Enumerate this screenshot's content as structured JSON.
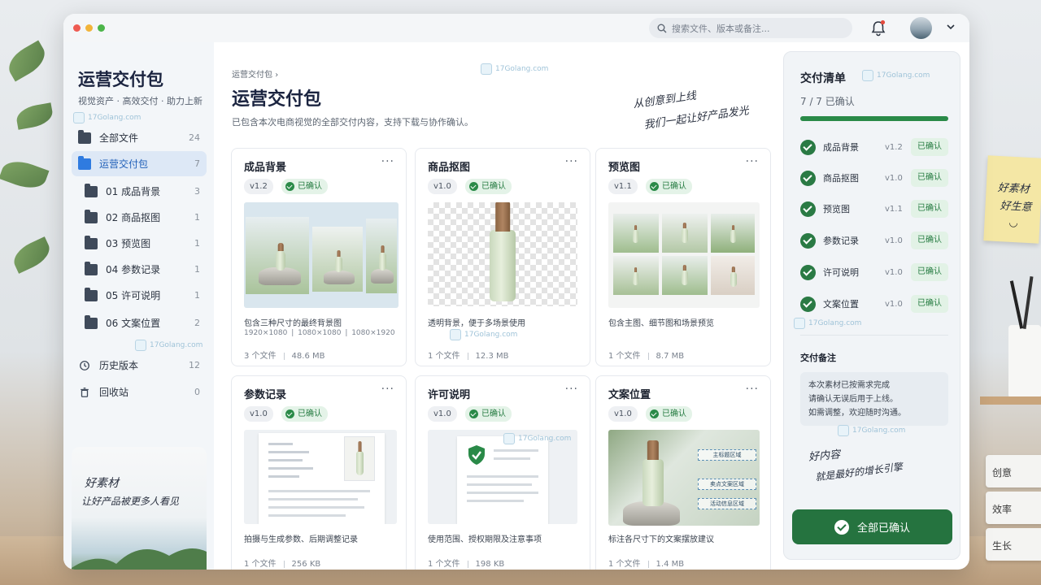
{
  "window": {
    "search_placeholder": "搜索文件、版本或备注..."
  },
  "sidebar": {
    "title": "运营交付包",
    "subtitle": "视觉资产 · 高效交付 · 助力上新",
    "items": [
      {
        "label": "全部文件",
        "count": "24"
      },
      {
        "label": "运营交付包",
        "count": "7"
      },
      {
        "label": "01 成品背景",
        "count": "3"
      },
      {
        "label": "02 商品抠图",
        "count": "1"
      },
      {
        "label": "03 预览图",
        "count": "1"
      },
      {
        "label": "04 参数记录",
        "count": "1"
      },
      {
        "label": "05 许可说明",
        "count": "1"
      },
      {
        "label": "06 文案位置",
        "count": "2"
      },
      {
        "label": "历史版本",
        "count": "12"
      },
      {
        "label": "回收站",
        "count": "0"
      }
    ],
    "promo_line1": "好素材",
    "promo_line2": "让好产品被更多人看见"
  },
  "main": {
    "breadcrumb": "运营交付包",
    "title": "运营交付包",
    "description": "已包含本次电商视觉的全部交付内容，支持下载与协作确认。",
    "handwriting_1": "从创意到上线",
    "handwriting_2": "我们一起让好产品发光",
    "cards": [
      {
        "title": "成品背景",
        "version": "v1.2",
        "status": "已确认",
        "desc": "包含三种尺寸的最终背景图",
        "dims": "1920×1080 | 1080×1080 | 1080×1920",
        "files": "3 个文件",
        "size": "48.6 MB"
      },
      {
        "title": "商品抠图",
        "version": "v1.0",
        "status": "已确认",
        "desc": "透明背景，便于多场景使用",
        "dims": "",
        "files": "1 个文件",
        "size": "12.3 MB"
      },
      {
        "title": "预览图",
        "version": "v1.1",
        "status": "已确认",
        "desc": "包含主图、细节图和场景预览",
        "dims": "",
        "files": "1 个文件",
        "size": "8.7 MB"
      },
      {
        "title": "参数记录",
        "version": "v1.0",
        "status": "已确认",
        "desc": "拍摄与生成参数、后期调整记录",
        "dims": "",
        "files": "1 个文件",
        "size": "256 KB"
      },
      {
        "title": "许可说明",
        "version": "v1.0",
        "status": "已确认",
        "desc": "使用范围、授权期限及注意事项",
        "dims": "",
        "files": "1 个文件",
        "size": "198 KB"
      },
      {
        "title": "文案位置",
        "version": "v1.0",
        "status": "已确认",
        "desc": "标注各尺寸下的文案摆放建议",
        "dims": "",
        "files": "1 个文件",
        "size": "1.4 MB"
      }
    ],
    "copy_zones": [
      "主标题区域",
      "卖点文案区域",
      "活动信息区域"
    ]
  },
  "checklist": {
    "title": "交付清单",
    "count": "7 / 7  已确认",
    "progress": 1.0,
    "items": [
      {
        "label": "成品背景",
        "version": "v1.2",
        "status": "已确认"
      },
      {
        "label": "商品抠图",
        "version": "v1.0",
        "status": "已确认"
      },
      {
        "label": "预览图",
        "version": "v1.1",
        "status": "已确认"
      },
      {
        "label": "参数记录",
        "version": "v1.0",
        "status": "已确认"
      },
      {
        "label": "许可说明",
        "version": "v1.0",
        "status": "已确认"
      },
      {
        "label": "文案位置",
        "version": "v1.0",
        "status": "已确认"
      }
    ],
    "note_title": "交付备注",
    "note_lines": [
      "本次素材已按需求完成",
      "请确认无误后用于上线。",
      "如需调整，欢迎随时沟通。"
    ],
    "handwriting_1": "好内容",
    "handwriting_2": "就是最好的增长引擎",
    "confirm_all": "全部已确认"
  },
  "watermark": "17Golang.com",
  "desk": {
    "sticky_line1": "好素材",
    "sticky_line2": "好生意",
    "books": [
      "创意",
      "效率",
      "生长"
    ]
  },
  "colors": {
    "accent": "#2f7be0",
    "success": "#2a8a48",
    "button": "#25733f"
  }
}
